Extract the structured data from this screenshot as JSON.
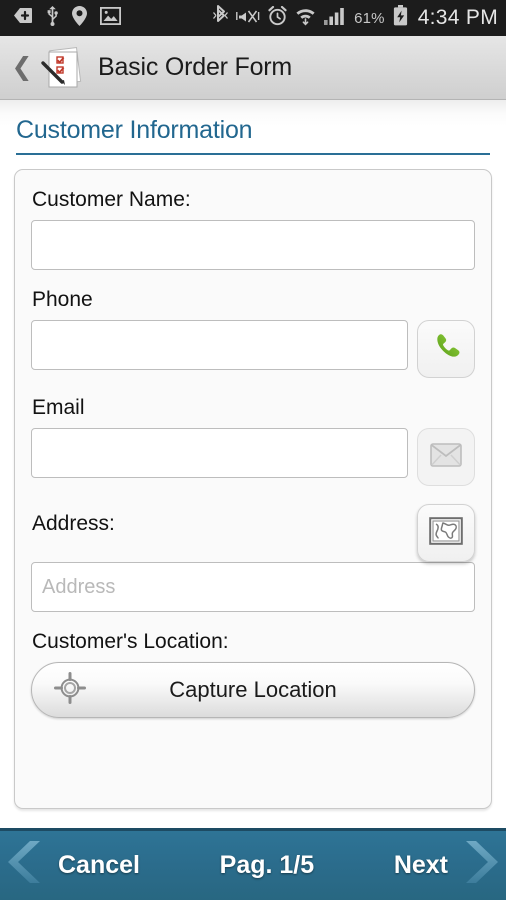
{
  "statusbar": {
    "icons_left": [
      "download-tag-icon",
      "usb-icon",
      "location-pin-icon",
      "gallery-image-icon"
    ],
    "icons_right": [
      "bluetooth-icon",
      "volume-vibrate-muted-icon",
      "alarm-clock-icon",
      "wifi-download-icon",
      "cellular-signal-icon"
    ],
    "battery_percent": "61%",
    "battery_icon": "battery-charging-icon",
    "time": "4:34 PM"
  },
  "titlebar": {
    "back_icon": "back-chevron-icon",
    "app_icon": "order-form-document-icon",
    "title": "Basic Order Form"
  },
  "section": {
    "title": "Customer Information",
    "accent_color": "#22678f"
  },
  "form": {
    "customer_name": {
      "label": "Customer Name:",
      "value": "",
      "placeholder": ""
    },
    "phone": {
      "label": "Phone",
      "value": "",
      "placeholder": "",
      "action_icon": "phone-call-icon",
      "action_color": "#76b82a"
    },
    "email": {
      "label": "Email",
      "value": "",
      "placeholder": "",
      "action_icon": "email-envelope-icon",
      "action_disabled": true
    },
    "address": {
      "label": "Address:",
      "value": "",
      "placeholder": "Address",
      "action_icon": "world-map-icon"
    },
    "location": {
      "label": "Customer's Location:",
      "button_label": "Capture Location",
      "button_icon": "gps-crosshair-icon"
    }
  },
  "footer": {
    "cancel_label": "Cancel",
    "cancel_icon": "chevron-left-icon",
    "page_label": "Pag. 1/5",
    "next_label": "Next",
    "next_icon": "chevron-right-icon",
    "background_color": "#2b6c8c"
  }
}
